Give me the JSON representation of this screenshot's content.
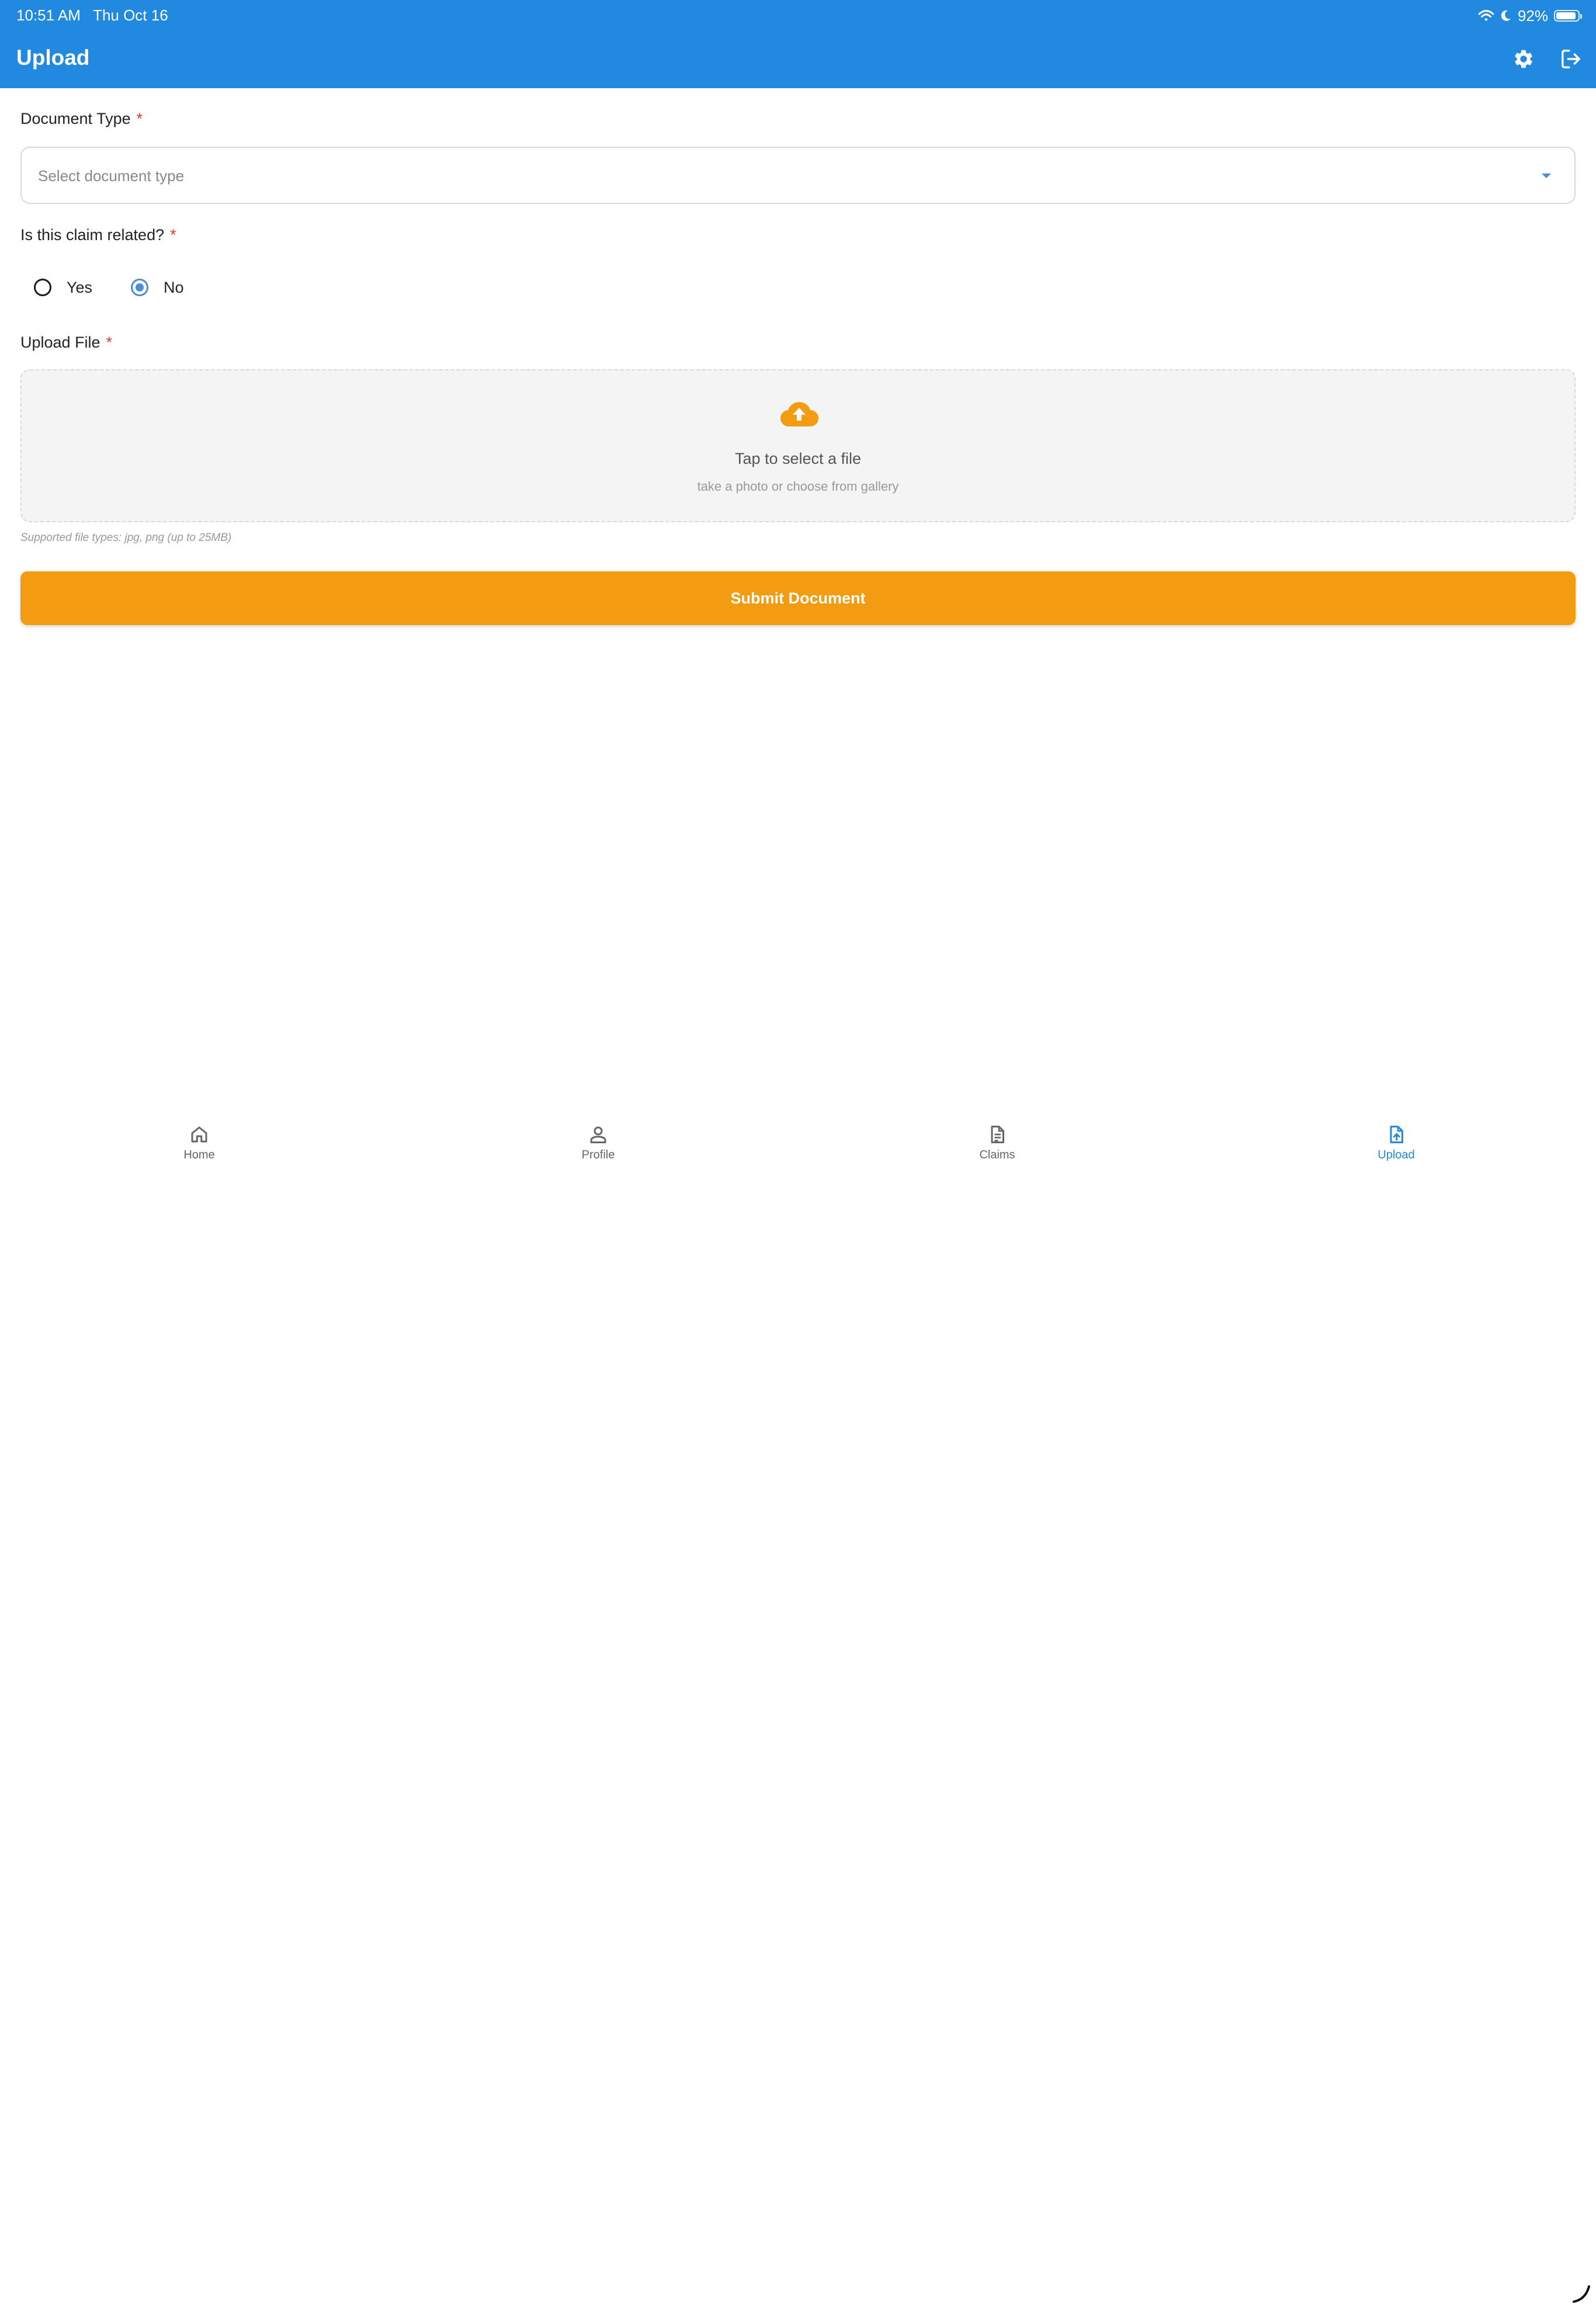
{
  "status_bar": {
    "time": "10:51 AM",
    "date": "Thu Oct 16",
    "battery": "92%",
    "battery_level": 0.92
  },
  "header": {
    "title": "Upload",
    "actions": [
      "settings-icon",
      "logout-icon"
    ],
    "background_color": "#2289e0"
  },
  "form": {
    "document_type": {
      "label": "Document Type",
      "required_mark": "*",
      "placeholder": "Select document type"
    },
    "claim_related": {
      "label": "Is this claim related?",
      "required_mark": "*",
      "options": [
        {
          "label": "Yes",
          "selected": false
        },
        {
          "label": "No",
          "selected": true
        }
      ]
    },
    "upload": {
      "label": "Upload File",
      "required_mark": "*",
      "title": "Tap to select a file",
      "subtitle": "take a photo or choose from gallery",
      "hint": "Supported file types: jpg, png (up to 25MB)"
    },
    "submit_label": "Submit Document",
    "accent_color": "#f39c12"
  },
  "bottom_nav": {
    "items": [
      {
        "label": "Home",
        "icon": "home-icon",
        "active": false
      },
      {
        "label": "Profile",
        "icon": "profile-icon",
        "active": false
      },
      {
        "label": "Claims",
        "icon": "document-icon",
        "active": false
      },
      {
        "label": "Upload",
        "icon": "upload-file-icon",
        "active": true
      }
    ]
  }
}
